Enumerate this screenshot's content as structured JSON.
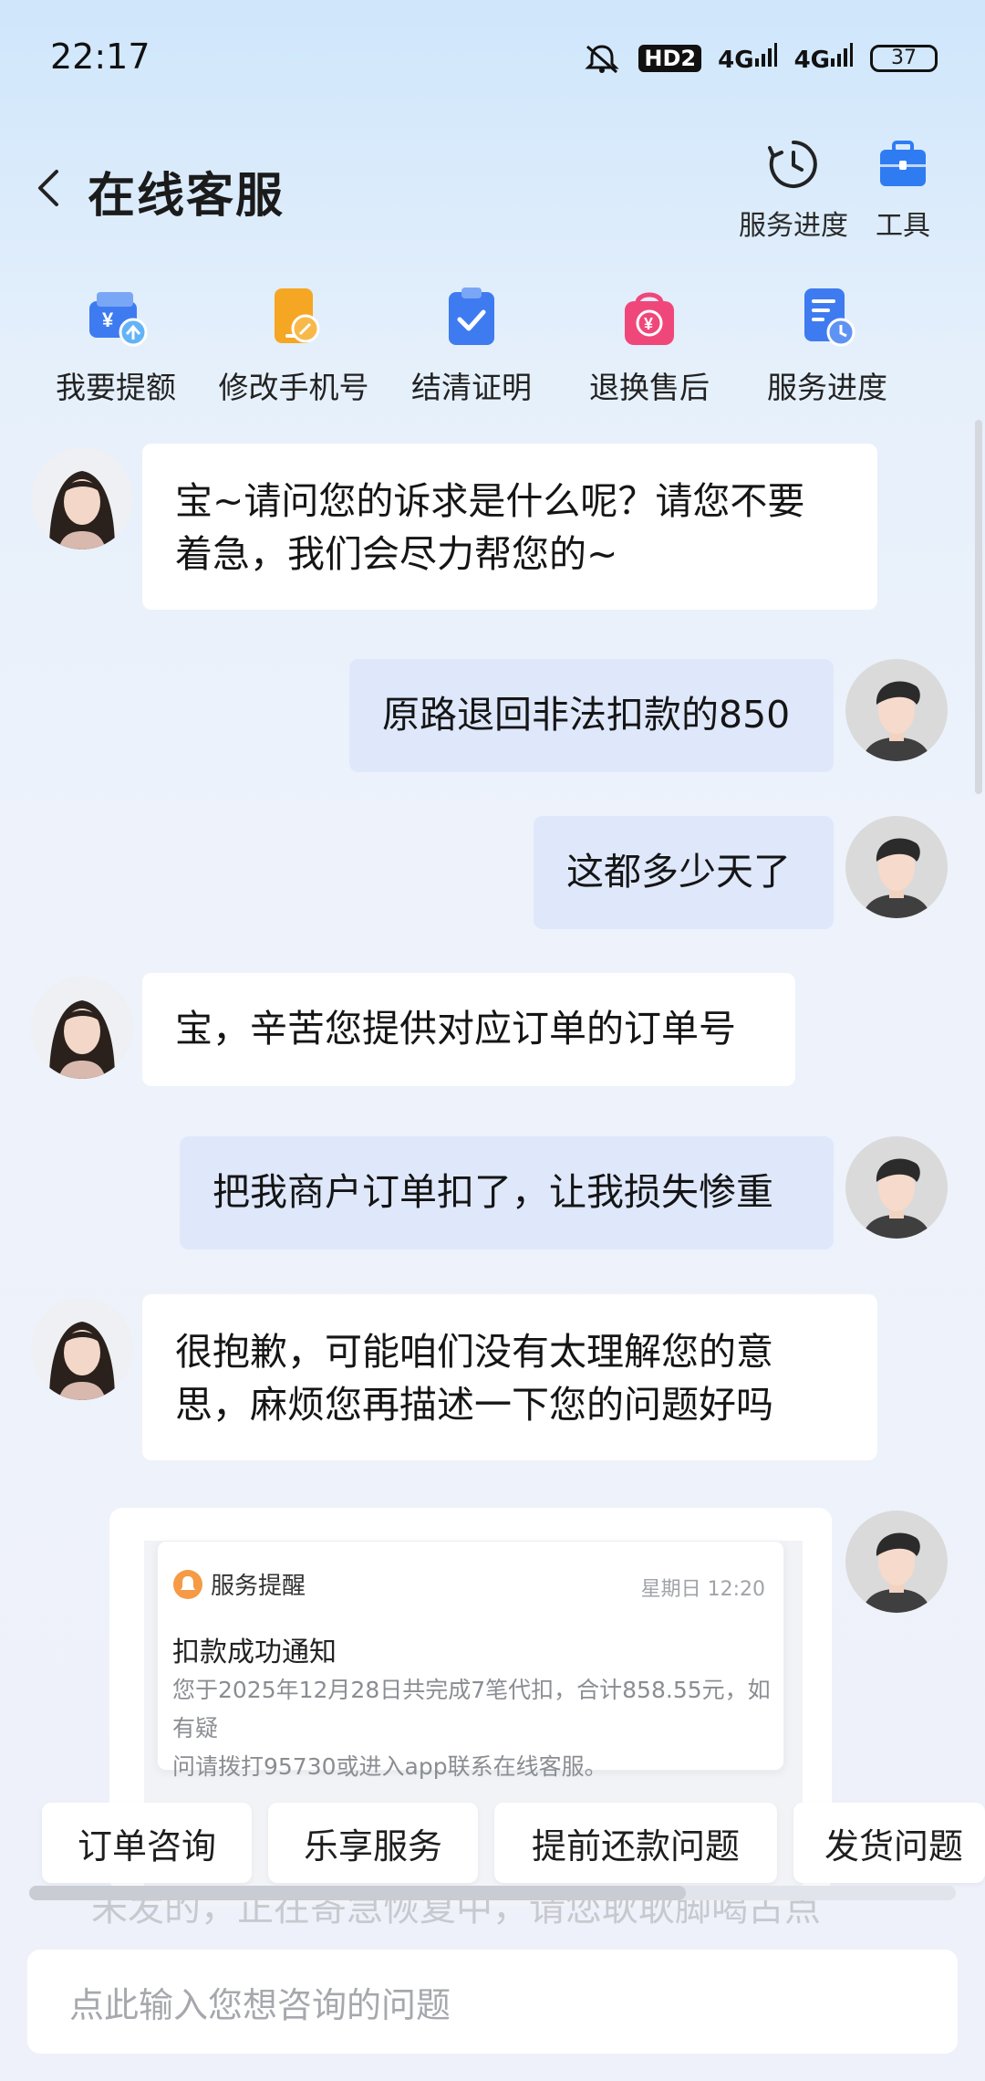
{
  "status_bar": {
    "time": "22:17",
    "hd": "HD2",
    "net1": "4G",
    "net2": "4G",
    "battery": "37"
  },
  "header": {
    "title": "在线客服",
    "tools": [
      {
        "label": "服务进度",
        "icon": "clock-icon"
      },
      {
        "label": "工具",
        "icon": "toolbox-icon"
      }
    ]
  },
  "shortcuts": [
    {
      "label": "我要提额",
      "icon": "wallet-up-icon",
      "color": "#3f7bf0"
    },
    {
      "label": "修改手机号",
      "icon": "phone-edit-icon",
      "color": "#f5a623"
    },
    {
      "label": "结清证明",
      "icon": "clipboard-check-icon",
      "color": "#3f7bf0"
    },
    {
      "label": "退换售后",
      "icon": "bag-refund-icon",
      "color": "#f0477a"
    },
    {
      "label": "服务进度",
      "icon": "doc-clock-icon",
      "color": "#3f7bf0"
    }
  ],
  "messages": [
    {
      "from": "agent",
      "text_lines": [
        "宝~请问您的诉求是什么呢？请您不要",
        "着急，我们会尽力帮您的~"
      ]
    },
    {
      "from": "user",
      "text": "原路退回非法扣款的850"
    },
    {
      "from": "user",
      "text": "这都多少天了"
    },
    {
      "from": "agent",
      "text": "宝，辛苦您提供对应订单的订单号"
    },
    {
      "from": "user",
      "text": "把我商户订单扣了，让我损失惨重"
    },
    {
      "from": "agent",
      "text_lines": [
        "很抱歉，可能咱们没有太理解您的意",
        "思，麻烦您再描述一下您的问题好吗"
      ]
    }
  ],
  "notification_card": {
    "source": "服务提醒",
    "time": "星期日 12:20",
    "title": "扣款成功通知",
    "body_lines": [
      "您于2025年12月28日共完成7笔代扣，合计858.55元，如有疑",
      "问请拨打95730或进入app联系在线客服。"
    ]
  },
  "quick_chips": [
    "订单咨询",
    "乐享服务",
    "提前还款问题",
    "发货问题"
  ],
  "hidden_text": "未发的，正在寄急恢复中，请您耿耿脚喝占点",
  "input": {
    "placeholder": "点此输入您想咨询的问题"
  }
}
